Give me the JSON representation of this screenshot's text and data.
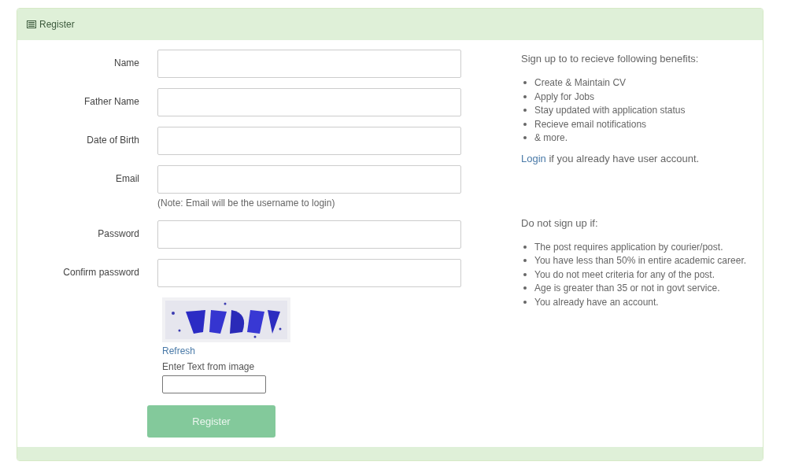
{
  "panel": {
    "title": "Register"
  },
  "fields": [
    {
      "label": "Name"
    },
    {
      "label": "Father Name"
    },
    {
      "label": "Date of Birth"
    },
    {
      "label": "Email",
      "note": "(Note: Email will be the username to login)"
    },
    {
      "label": "Password"
    },
    {
      "label": "Confirm password"
    }
  ],
  "captcha": {
    "refresh": "Refresh",
    "prompt": "Enter Text from image"
  },
  "submit": "Register",
  "benefits": {
    "heading": "Sign up to to recieve following benefits:",
    "items": [
      "Create & Maintain CV",
      "Apply for Jobs",
      "Stay updated with application status",
      "Recieve email notifications",
      "& more."
    ],
    "login_link": "Login",
    "login_text": " if you already have user account."
  },
  "restrictions": {
    "heading": "Do not sign up if:",
    "items": [
      "The post requires application by courier/post.",
      "You have less than 50% in entire academic career.",
      "You do not meet criteria for any of the post.",
      "Age is greater than 35 or not in govt service.",
      "You already have an account."
    ]
  }
}
